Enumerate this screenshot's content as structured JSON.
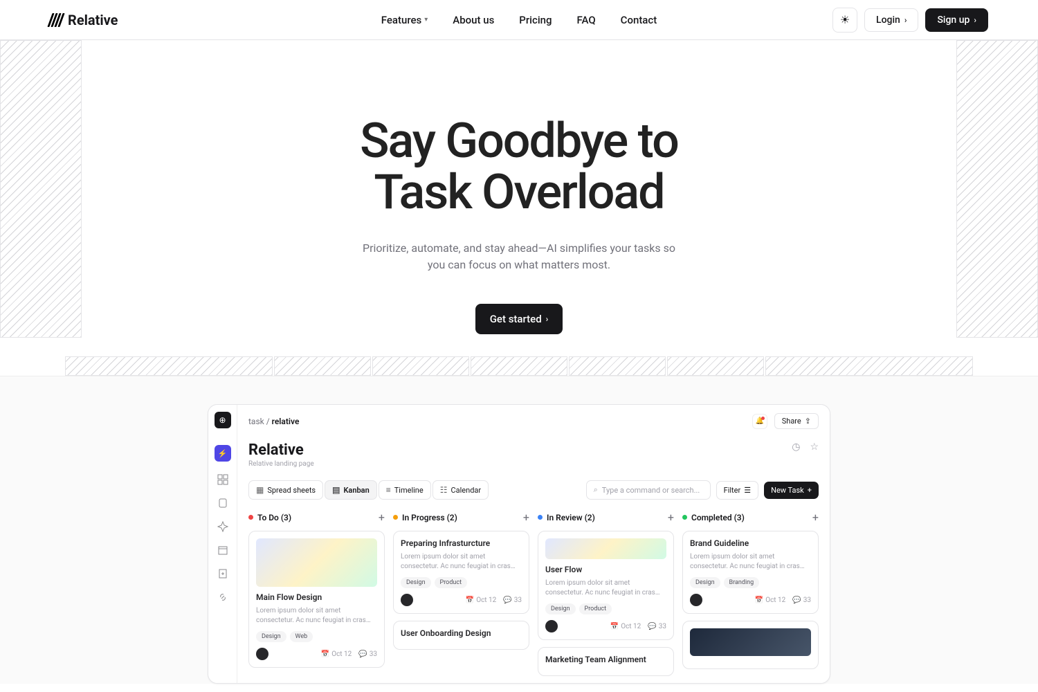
{
  "brand": "Relative",
  "nav": [
    "Features",
    "About us",
    "Pricing",
    "FAQ",
    "Contact"
  ],
  "login": "Login",
  "signup": "Sign up",
  "hero": {
    "title1": "Say Goodbye to",
    "title2": "Task Overload",
    "subtitle": "Prioritize, automate, and stay ahead—AI simplifies your tasks so you can focus on what matters most.",
    "cta": "Get started"
  },
  "app": {
    "crumb1": "task",
    "crumb2": "relative",
    "share": "Share",
    "title": "Relative",
    "subtitle": "Relative landing page",
    "views": [
      {
        "icon": "▦",
        "label": "Spread sheets"
      },
      {
        "icon": "▤",
        "label": "Kanban"
      },
      {
        "icon": "≡",
        "label": "Timeline"
      },
      {
        "icon": "☷",
        "label": "Calendar"
      }
    ],
    "search_ph": "Type a command or search...",
    "filter": "Filter",
    "newtask": "New Task",
    "cols": [
      {
        "dot": "d-red",
        "title": "To Do (3)"
      },
      {
        "dot": "d-org",
        "title": "In Progress (2)"
      },
      {
        "dot": "d-blu",
        "title": "In Review (2)"
      },
      {
        "dot": "d-grn",
        "title": "Completed (3)"
      }
    ],
    "desc": "Lorem ipsum dolor sit amet consectetur. Ac nunc feugiat in cras velit integer in co...",
    "date": "Oct 12",
    "comments": "33",
    "cards": {
      "c1": {
        "title": "Main Flow Design",
        "t1": "Design",
        "t2": "Web"
      },
      "c2": {
        "title": "Preparing Infrasturcture",
        "t1": "Design",
        "t2": "Product"
      },
      "c3": {
        "title": "User Onboarding Design"
      },
      "c4": {
        "title": "User Flow",
        "t1": "Design",
        "t2": "Product"
      },
      "c5": {
        "title": "Marketing Team Alignment"
      },
      "c6": {
        "title": "Brand Guideline",
        "t1": "Design",
        "t2": "Branding"
      }
    }
  }
}
